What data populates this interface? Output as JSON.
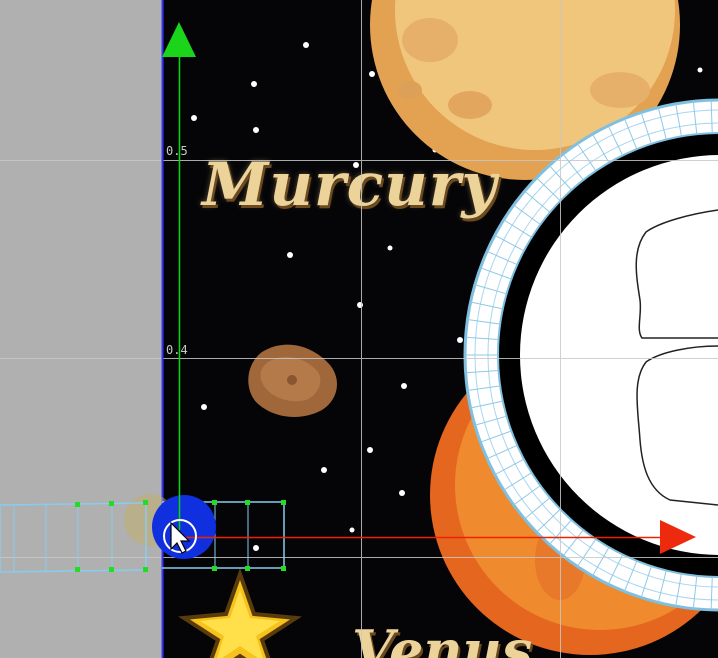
{
  "editor": {
    "grid_labels": {
      "y_0_5": "0.5",
      "y_0_4": "0.4"
    },
    "colors": {
      "outside_canvas": "#b0b0b0",
      "grid_line": "#c8c8c8",
      "y_axis": "#00dd00",
      "x_axis": "#ee2200",
      "selection_handle": "#22dd22",
      "rect_outline": "#88ccee",
      "canvas_border": "#3333ff"
    },
    "gizmo": {
      "y_axis_handle": "y-arrow-icon",
      "x_axis_handle": "x-arrow-icon",
      "center_handle": "move-center-icon",
      "cursor": "mouse-pointer-icon"
    }
  },
  "scene": {
    "title_top": "Murcury",
    "title_bottom": "Venus"
  }
}
